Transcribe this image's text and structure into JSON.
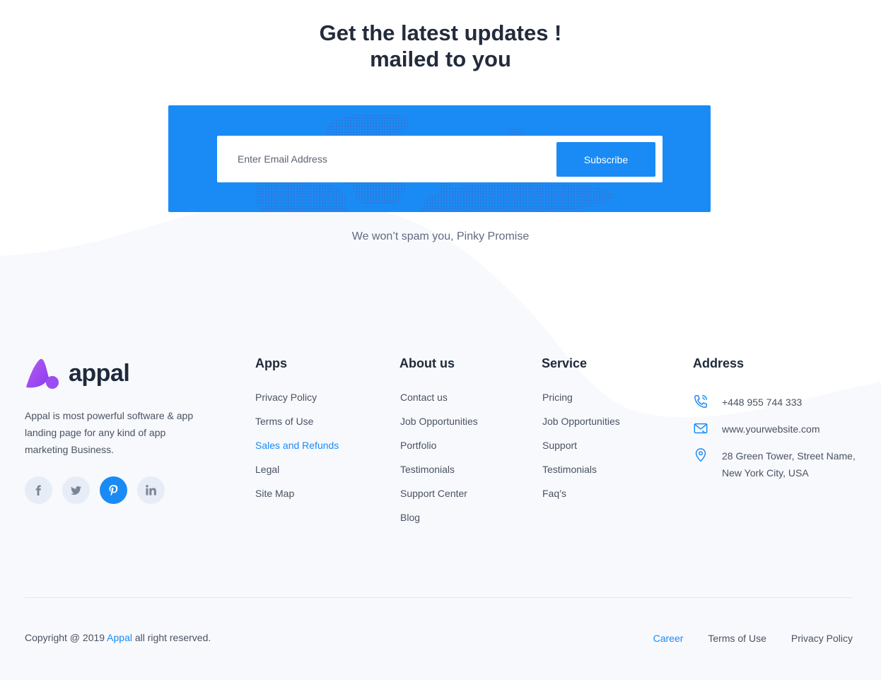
{
  "newsletter": {
    "headline_line1": "Get the latest updates !",
    "headline_line2": "mailed to you",
    "email_placeholder": "Enter Email Address",
    "subscribe_label": "Subscribe",
    "spam_note": "We won’t spam you, Pinky Promise"
  },
  "brand": {
    "name": "appal",
    "description": "Appal is most powerful software & app landing page for any kind of app marketing Business.",
    "socials": [
      {
        "icon": "facebook-icon"
      },
      {
        "icon": "twitter-icon"
      },
      {
        "icon": "pinterest-icon",
        "active": true
      },
      {
        "icon": "linkedin-icon"
      }
    ]
  },
  "columns": {
    "apps": {
      "title": "Apps",
      "links": [
        "Privacy Policy",
        "Terms of Use",
        "Sales and Refunds",
        "Legal",
        "Site Map"
      ],
      "highlighted": "Sales and Refunds"
    },
    "about": {
      "title": "About us",
      "links": [
        "Contact us",
        "Job Opportunities",
        "Portfolio",
        "Testimonials",
        "Support Center",
        "Blog"
      ]
    },
    "service": {
      "title": "Service",
      "links": [
        "Pricing",
        "Job Opportunities",
        "Support",
        "Testimonials",
        "Faq’s"
      ]
    },
    "address": {
      "title": "Address",
      "phone": "+448 955 744 333",
      "website": "www.yourwebsite.com",
      "street": "28 Green Tower, Street Name,",
      "city": "New York City, USA"
    }
  },
  "bottom": {
    "copyright_prefix": "Copyright @ 2019 ",
    "copyright_brand": "Appal",
    "copyright_suffix": " all right reserved.",
    "links": [
      "Career",
      "Terms of Use",
      "Privacy Policy"
    ],
    "highlighted": "Career"
  },
  "colors": {
    "accent": "#1a8bf5",
    "footer_bg": "#f7f9fd",
    "heading": "#232b3b",
    "text": "#4a5261"
  }
}
